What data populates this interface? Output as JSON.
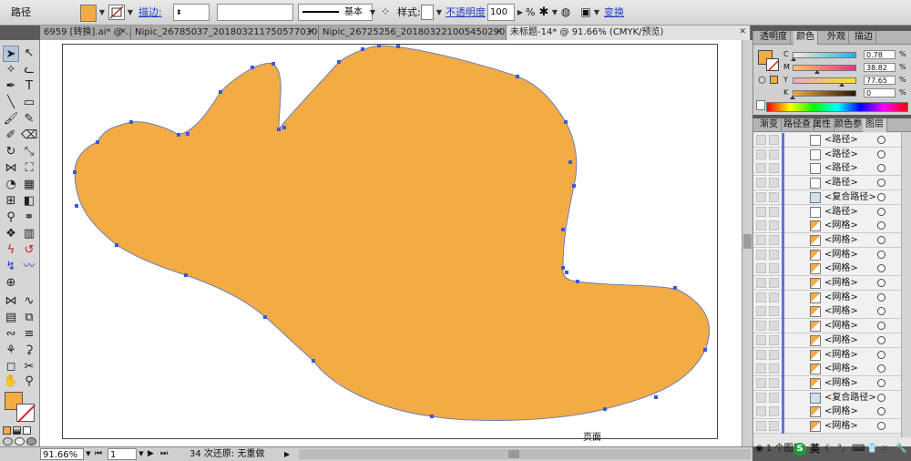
{
  "control_bar": {
    "object_type": "路径",
    "stroke_label": "描边:",
    "stroke_profile": "基本",
    "style_label": "样式:",
    "opacity_label": "不透明度",
    "opacity_value": "100",
    "opacity_unit": "%",
    "transform_label": "变换"
  },
  "doc_tabs": [
    {
      "label": "6959 [转换].ai* @ ...",
      "active": false
    },
    {
      "label": "Nipic_26785037_20180321175057703037.ai*",
      "active": false
    },
    {
      "label": "Nipic_26725256_20180322100545029030.ai*",
      "active": false
    },
    {
      "label": "未标题-14* @ 91.66% (CMYK/预览)",
      "active": true
    }
  ],
  "canvas": {
    "page_label": "页面",
    "shape_fill": "#f3ab44",
    "shape_stroke": "#6d7fb3",
    "anchor_color": "#3a5bd8"
  },
  "status_bar": {
    "zoom": "91.66%",
    "page": "1",
    "history": "34 次还原: 无重做"
  },
  "color_panel": {
    "tabs": [
      "透明度",
      "颜色",
      "外观",
      "描边"
    ],
    "active_tab": "颜色",
    "sliders": [
      {
        "letter": "C",
        "value": "0.78",
        "fraction": 0.0078,
        "gradient": "linear-gradient(to right,#fbe9d5,#1db3e8)"
      },
      {
        "letter": "M",
        "value": "38.82",
        "fraction": 0.3882,
        "gradient": "linear-gradient(to right,#f7c46d,#e5338b)"
      },
      {
        "letter": "Y",
        "value": "77.65",
        "fraction": 0.7765,
        "gradient": "linear-gradient(to right,#f5a4c7,#f8e01a)"
      },
      {
        "letter": "K",
        "value": "0",
        "fraction": 0.0,
        "gradient": "linear-gradient(to right,#f3ab44,#2b1605)"
      }
    ],
    "percent_unit": "%"
  },
  "layers_panel": {
    "tabs": [
      "渐变",
      "路径查",
      "属性",
      "颜色参",
      "图层"
    ],
    "active_tab": "图层",
    "rows": [
      {
        "name": "<路径>",
        "type": "path"
      },
      {
        "name": "<路径>",
        "type": "path"
      },
      {
        "name": "<路径>",
        "type": "path"
      },
      {
        "name": "<路径>",
        "type": "path"
      },
      {
        "name": "<复合路径>",
        "type": "compound"
      },
      {
        "name": "<路径>",
        "type": "path"
      },
      {
        "name": "<网格>",
        "type": "mesh"
      },
      {
        "name": "<网格>",
        "type": "mesh"
      },
      {
        "name": "<网格>",
        "type": "mesh"
      },
      {
        "name": "<网格>",
        "type": "mesh"
      },
      {
        "name": "<网格>",
        "type": "mesh"
      },
      {
        "name": "<网格>",
        "type": "mesh"
      },
      {
        "name": "<网格>",
        "type": "mesh"
      },
      {
        "name": "<网格>",
        "type": "mesh"
      },
      {
        "name": "<网格>",
        "type": "mesh"
      },
      {
        "name": "<网格>",
        "type": "mesh"
      },
      {
        "name": "<网格>",
        "type": "mesh"
      },
      {
        "name": "<网格>",
        "type": "mesh"
      },
      {
        "name": "<复合路径>",
        "type": "compound"
      },
      {
        "name": "<网格>",
        "type": "mesh"
      },
      {
        "name": "<网格>",
        "type": "mesh"
      }
    ],
    "footer_count": "1 个图层",
    "ime_label": "英"
  }
}
